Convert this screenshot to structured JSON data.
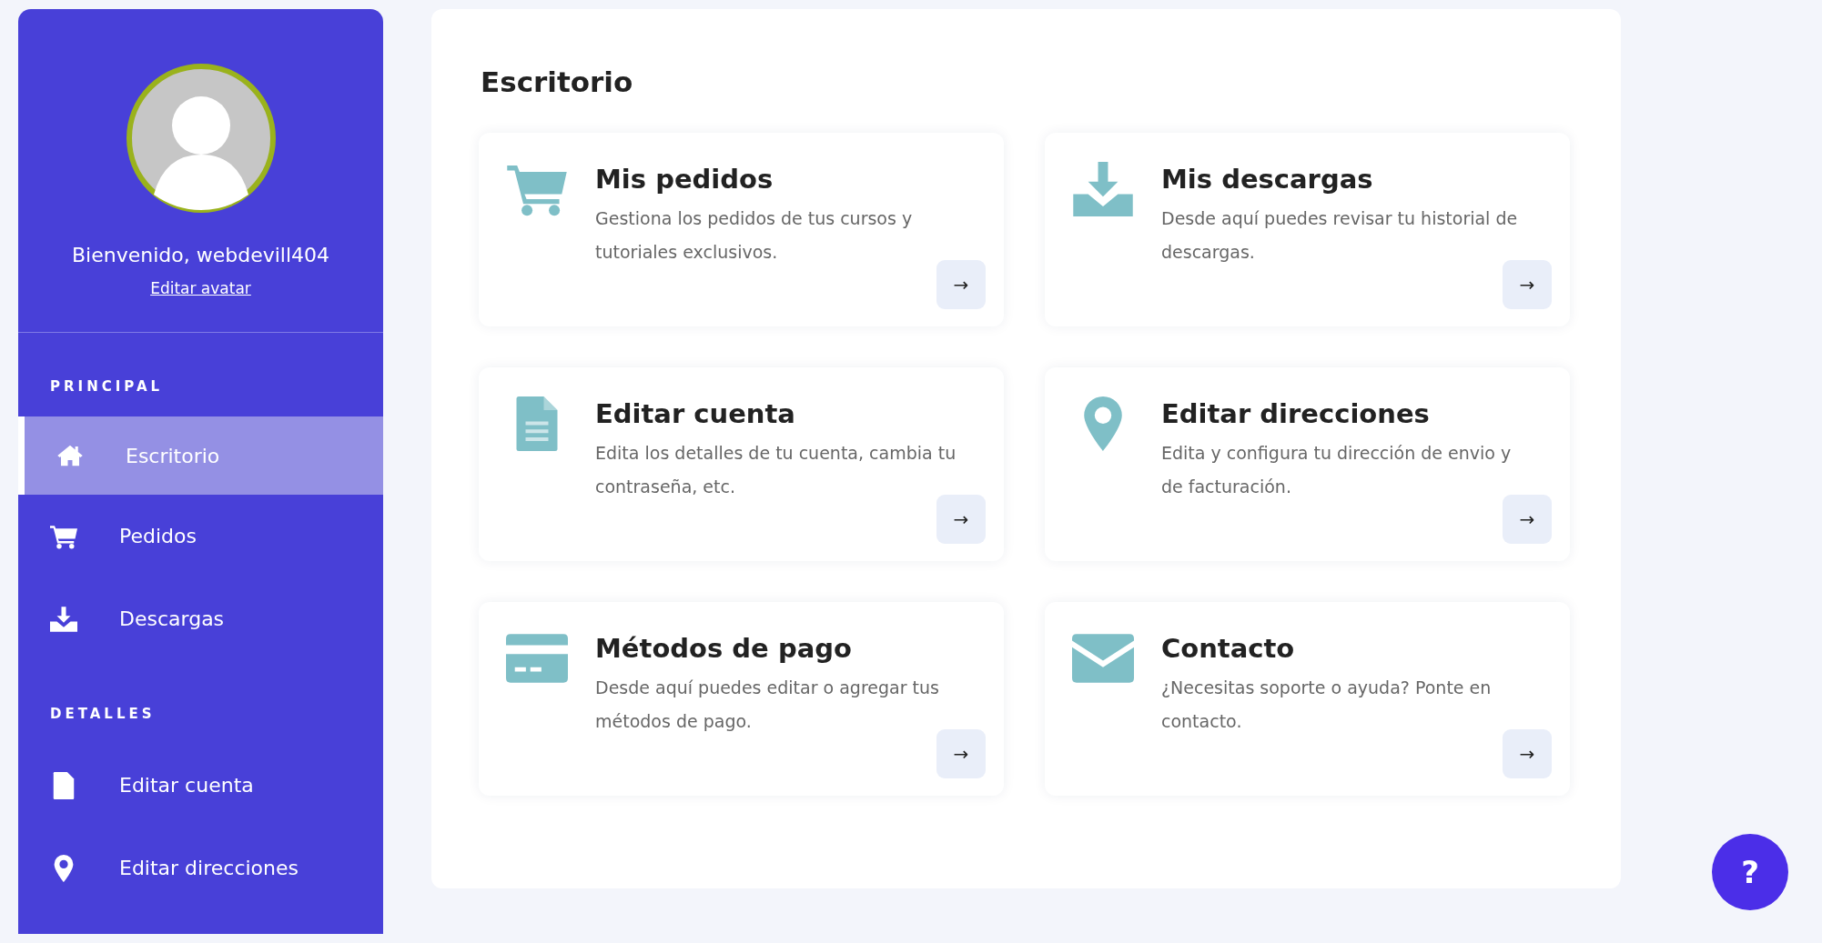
{
  "profile": {
    "welcome": "Bienvenido, webdevill404",
    "edit_avatar_link": "Editar avatar"
  },
  "sidebar": {
    "sections": [
      {
        "heading": "PRINCIPAL",
        "items": [
          {
            "label": "Escritorio",
            "selected": true
          },
          {
            "label": "Pedidos",
            "selected": false
          },
          {
            "label": "Descargas",
            "selected": false
          }
        ]
      },
      {
        "heading": "DETALLES",
        "items": [
          {
            "label": "Editar cuenta",
            "selected": false
          },
          {
            "label": "Editar direcciones",
            "selected": false
          }
        ]
      }
    ]
  },
  "main": {
    "title": "Escritorio",
    "cards": [
      {
        "title": "Mis pedidos",
        "description": "Gestiona los pedidos de tus cursos y tutoriales exclusivos.",
        "button": "→"
      },
      {
        "title": "Mis descargas",
        "description": "Desde aquí puedes revisar tu historial de descargas.",
        "button": "→"
      },
      {
        "title": "Editar cuenta",
        "description": "Edita los detalles de tu cuenta, cambia tu contraseña, etc.",
        "button": "→"
      },
      {
        "title": "Editar direcciones",
        "description": "Edita y configura tu dirección de envio y de facturación.",
        "button": "→"
      },
      {
        "title": "Métodos de pago",
        "description": "Desde aquí puedes editar o agregar tus métodos de pago.",
        "button": "→"
      },
      {
        "title": "Contacto",
        "description": "¿Necesitas soporte o ayuda? Ponte en contacto.",
        "button": "→"
      }
    ]
  },
  "help_button": {
    "label": "?"
  }
}
